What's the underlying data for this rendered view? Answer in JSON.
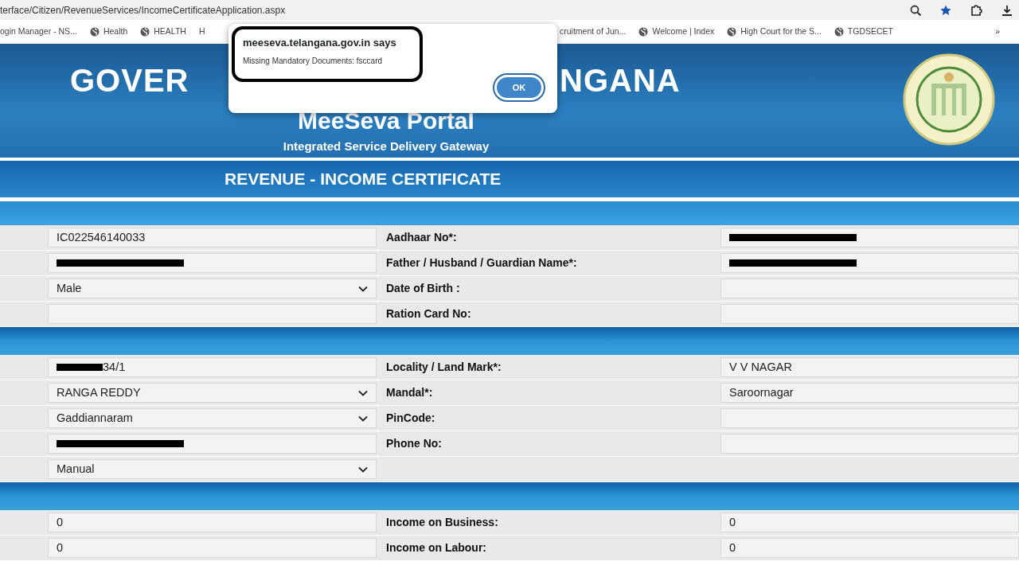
{
  "browser": {
    "url": "terface/Citizen/RevenueServices/IncomeCertificateApplication.aspx",
    "bookmarks": [
      {
        "label": "ogin Manager - NS...",
        "icon": false
      },
      {
        "label": "Health",
        "icon": true
      },
      {
        "label": "HEALTH",
        "icon": true
      },
      {
        "label": "H",
        "icon": false
      },
      {
        "label": "cruitment of Jun...",
        "icon": false
      },
      {
        "label": "Welcome | Index",
        "icon": true
      },
      {
        "label": "High Court for the S...",
        "icon": true
      },
      {
        "label": "TGDSECET",
        "icon": true
      }
    ],
    "more": "»"
  },
  "header": {
    "title_parts": [
      "GOVER",
      "NGANA"
    ],
    "portal": "MeeSeva Portal",
    "tagline": "Integrated Service Delivery Gateway"
  },
  "page_title": "REVENUE - INCOME CERTIFICATE",
  "sections": [
    {
      "rows": [
        {
          "left": {
            "kind": "text",
            "value": "IC022546140033"
          },
          "label": "Aadhaar No*:",
          "right": {
            "kind": "redacted"
          }
        },
        {
          "left": {
            "kind": "redacted"
          },
          "label": "Father / Husband / Guardian Name*:",
          "right": {
            "kind": "redacted"
          }
        },
        {
          "left": {
            "kind": "select",
            "value": "Male"
          },
          "label": "Date of Birth :",
          "right": {
            "kind": "text"
          }
        },
        {
          "left": {
            "kind": "text"
          },
          "label": "Ration Card No:",
          "right": {
            "kind": "text"
          }
        }
      ]
    },
    {
      "rows": [
        {
          "left": {
            "kind": "redacted",
            "value": "34/1"
          },
          "label": "Locality / Land Mark*:",
          "right": {
            "kind": "text",
            "value": "V V NAGAR"
          }
        },
        {
          "left": {
            "kind": "select",
            "value": "RANGA REDDY"
          },
          "label": "Mandal*:",
          "right": {
            "kind": "text",
            "value": "Saroornagar"
          }
        },
        {
          "left": {
            "kind": "select",
            "value": "Gaddiannaram"
          },
          "label": "PinCode:",
          "right": {
            "kind": "text"
          }
        },
        {
          "left": {
            "kind": "redacted"
          },
          "label": "Phone No:",
          "right": {
            "kind": "text"
          }
        },
        {
          "left": {
            "kind": "select",
            "value": "Manual"
          }
        }
      ]
    },
    {
      "rows": [
        {
          "left": {
            "kind": "text",
            "value": "0"
          },
          "label": "Income on Business:",
          "right": {
            "kind": "text",
            "value": "0"
          }
        },
        {
          "left": {
            "kind": "text",
            "value": "0"
          },
          "label": "Income on Labour:",
          "right": {
            "kind": "text",
            "value": "0"
          }
        }
      ]
    }
  ],
  "dialog": {
    "title": "meeseva.telangana.gov.in says",
    "message": "Missing Mandatory Documents: fsccard",
    "button": "OK"
  }
}
